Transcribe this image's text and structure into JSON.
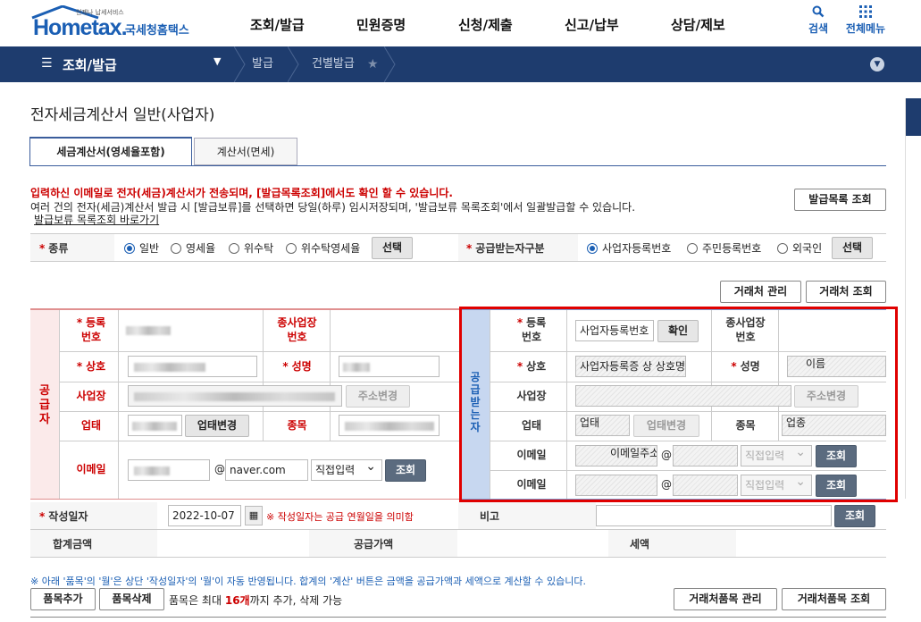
{
  "header": {
    "logo_text": "Hometax.",
    "logo_sub": "국세청홈택스",
    "logo_tiny": "언제나 납세서비스",
    "gnb": [
      "조회/발급",
      "민원증명",
      "신청/제출",
      "신고/납부",
      "상담/제보"
    ],
    "search_label": "검색",
    "menu_label": "전체메뉴"
  },
  "navbar": {
    "section": "조회/발급",
    "crumb1": "발급",
    "crumb2": "건별발급"
  },
  "page_title": "전자세금계산서 일반(사업자)",
  "tabs": [
    "세금계산서(영세율포함)",
    "계산서(면세)"
  ],
  "notice": {
    "line1": "입력하신 이메일로 전자(세금)계산서가 전송되며, [발급목록조회]에서도 확인 할 수 있습니다.",
    "line2": "여러 건의 전자(세금)계산서 발급 시 [발급보류]를 선택하면 당일(하루) 임시저장되며, '발급보류 목록조회'에서 일괄발급할 수 있습니다.",
    "link": "발급보류 목록조회 바로가기",
    "list_button": "발급목록 조회"
  },
  "kind": {
    "label": "종류",
    "options": [
      "일반",
      "영세율",
      "위수탁",
      "위수탁영세율"
    ],
    "select_button": "선택",
    "receiver_label": "공급받는자구분",
    "receiver_options": [
      "사업자등록번호",
      "주민등록번호",
      "외국인"
    ],
    "receiver_select": "선택"
  },
  "client_buttons": {
    "manage": "거래처 관리",
    "search": "거래처 조회"
  },
  "supplier": {
    "side_label": "공급자",
    "reg_no": "등록\n번호",
    "sub_biz": "종사업장\n번호",
    "company": "상호",
    "name": "성명",
    "address": "사업장",
    "address_btn": "주소변경",
    "biz_type": "업태",
    "biz_type_btn": "업태변경",
    "item": "종목",
    "email": "이메일",
    "email_at": "@",
    "email_domain": "naver.com",
    "email_select": "직접입력",
    "email_btn": "조회"
  },
  "receiver": {
    "side_label": "공급받는자",
    "reg_no": "등록\n번호",
    "reg_no_value": "사업자등록번호",
    "confirm_btn": "확인",
    "sub_biz": "종사업장\n번호",
    "company": "상호",
    "company_value": "사업자등록증 상 상호명",
    "name": "성명",
    "name_value": "이름",
    "address": "사업장",
    "address_btn": "주소변경",
    "biz_type": "업태",
    "biz_type_value": "업태",
    "biz_type_btn": "업태변경",
    "item": "종목",
    "item_value": "업종",
    "email1": "이메일",
    "email1_value": "이메일주소",
    "email2": "이메일",
    "email_at": "@",
    "email_select": "직접입력",
    "email_btn": "조회"
  },
  "write_date": {
    "label": "작성일자",
    "value": "2022-10-07",
    "note": "※ 작성일자는 공급 연월일을 의미함",
    "memo_label": "비고",
    "memo_btn": "조회"
  },
  "totals": {
    "total": "합계금액",
    "supply": "공급가액",
    "tax": "세액"
  },
  "items_notice": "※ 아래 '품목'의 '월'은 상단 '작성일자'의 '월'이 자동 반영됩니다. 합계의 '계산' 버튼은 금액을 공급가액과 세액으로 계산할 수 있습니다.",
  "item_buttons": {
    "add": "품목추가",
    "delete": "품목삭제",
    "limit_pre": "품목은 최대 ",
    "limit_num": "16개",
    "limit_post": "까지 추가, 삭제 가능",
    "manage": "거래처품목 관리",
    "search": "거래처품목 조회"
  },
  "colors": {
    "accent": "#1b5fb4",
    "nav": "#1e3c6e",
    "highlight": "#e00000",
    "required": "#cc0000"
  }
}
